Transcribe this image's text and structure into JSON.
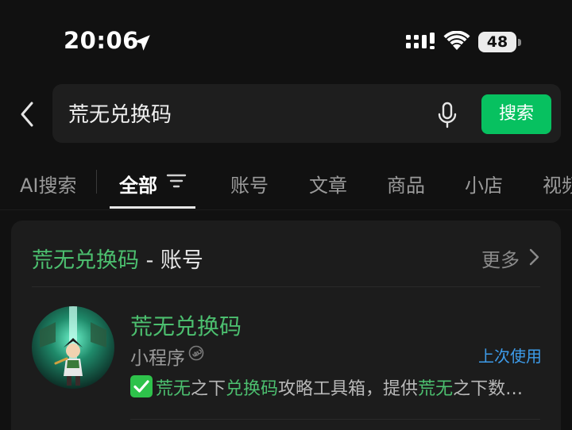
{
  "status_bar": {
    "time": "20:06",
    "battery": "48",
    "icons": [
      "location-arrow-icon",
      "cellular-signal-icon",
      "wifi-icon",
      "battery-icon"
    ]
  },
  "search": {
    "query": "荒无兑换码",
    "button_label": "搜索",
    "icons": [
      "back-chevron-icon",
      "microphone-icon"
    ]
  },
  "tabs": [
    {
      "label": "AI搜索"
    },
    {
      "label": "全部",
      "active": true
    },
    {
      "label": "账号"
    },
    {
      "label": "文章"
    },
    {
      "label": "商品"
    },
    {
      "label": "小店"
    },
    {
      "label": "视频"
    }
  ],
  "section": {
    "title_highlight": "荒无兑换码",
    "title_rest": " - 账号",
    "more_label": "更多"
  },
  "result": {
    "name": "荒无兑换码",
    "type": "小程序",
    "last_used": "上次使用",
    "desc_parts": [
      {
        "text": "荒无",
        "hl": true
      },
      {
        "text": "之下",
        "hl": false
      },
      {
        "text": "兑换码",
        "hl": true
      },
      {
        "text": "攻略工具箱，提供",
        "hl": false
      },
      {
        "text": "荒无",
        "hl": true
      },
      {
        "text": "之下数…",
        "hl": false
      }
    ]
  },
  "colors": {
    "accent_green": "#07c160",
    "highlight_green": "#4cbf6f",
    "link_blue": "#3d9be9",
    "background": "#111111",
    "card": "#1c1c1c"
  }
}
